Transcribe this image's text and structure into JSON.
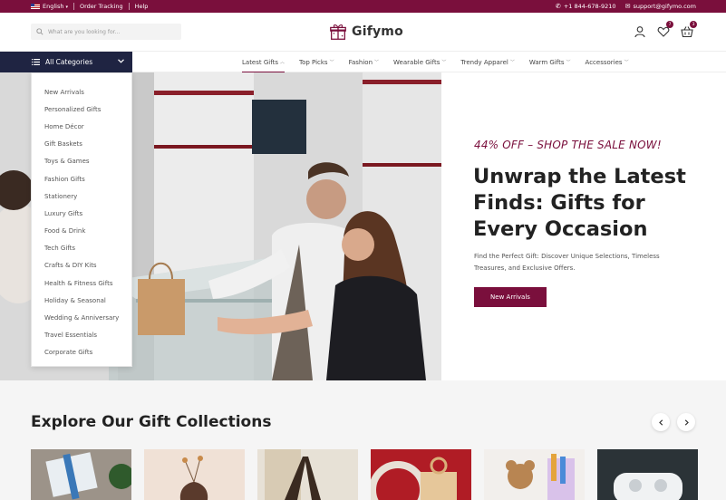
{
  "topbar": {
    "language": "English",
    "order_tracking": "Order Tracking",
    "help": "Help",
    "phone": "+1 844-678-9210",
    "email": "support@gifymo.com",
    "bg_color": "#7a0f3c"
  },
  "header": {
    "search_placeholder": "What are you looking for...",
    "brand": "Gifymo",
    "wishlist_count": "7",
    "cart_count": "3"
  },
  "nav": {
    "all_categories": "All Categories",
    "links": [
      {
        "label": "Latest Gifts",
        "active": true
      },
      {
        "label": "Top Picks"
      },
      {
        "label": "Fashion"
      },
      {
        "label": "Wearable Gifts"
      },
      {
        "label": "Trendy Apparel"
      },
      {
        "label": "Warm Gifts"
      },
      {
        "label": "Accessories"
      }
    ]
  },
  "categories": [
    "New Arrivals",
    "Personalized Gifts",
    "Home Décor",
    "Gift Baskets",
    "Toys & Games",
    "Fashion Gifts",
    "Stationery",
    "Luxury Gifts",
    "Food & Drink",
    "Tech Gifts",
    "Crafts & DIY Kits",
    "Health & Fitness Gifts",
    "Holiday & Seasonal",
    "Wedding & Anniversary",
    "Travel Essentials",
    "Corporate Gifts"
  ],
  "hero": {
    "promo": "44% OFF – SHOP THE SALE NOW!",
    "headline": "Unwrap the Latest Finds:  Gifts for Every Occasion",
    "subtext": "Find the Perfect Gift: Discover Unique Selections, Timeless Treasures, and Exclusive Offers.",
    "cta": "New Arrivals"
  },
  "explore": {
    "title": "Explore Our Gift Collections"
  },
  "colors": {
    "accent": "#7a0f3c",
    "nav_dark": "#1f2442"
  }
}
